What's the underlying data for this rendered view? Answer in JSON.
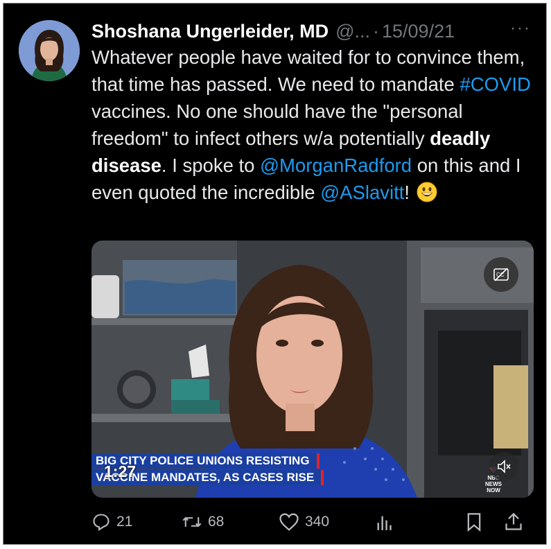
{
  "tweet": {
    "author_name": "Shoshana Ungerleider, MD",
    "handle": "@...",
    "separator": "·",
    "date": "15/09/21",
    "more": "···",
    "text_parts": {
      "p1": "Whatever people have waited for to convince them, that time has passed. We need to mandate ",
      "hashtag": "#COVID",
      "p2": " vaccines. No one should have the \"personal freedom\" to infect others w/a potentially ",
      "bold": "deadly disease",
      "p3": ". I spoke to ",
      "mention1": "@MorganRadford",
      "p4": " on this and I even quoted the incredible ",
      "mention2": "@ASlavitt",
      "p5": "!"
    },
    "emoji": "grinning-face"
  },
  "video": {
    "chyron_line1": "BIG CITY POLICE UNIONS RESISTING",
    "chyron_line2": "VACCINE MANDATES, AS CASES RISE",
    "timer": "1:27",
    "network": "NBC NEWS NOW",
    "chyron_color": "#1a3fa0",
    "accent_color": "#e0242b"
  },
  "actions": {
    "replies": "21",
    "retweets": "68",
    "likes": "340"
  },
  "colors": {
    "background": "#000000",
    "link": "#1d9bf0",
    "muted": "#71767b",
    "text": "#e7e9ea"
  }
}
